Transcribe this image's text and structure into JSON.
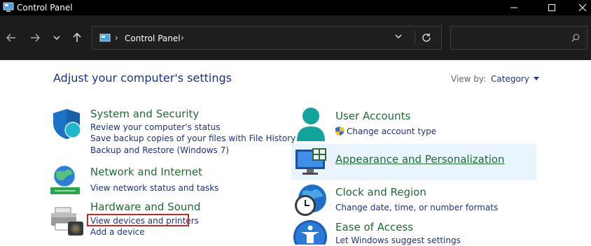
{
  "window": {
    "title": "Control Panel"
  },
  "nav": {
    "breadcrumb": "Control Panel",
    "search_placeholder": ""
  },
  "main": {
    "heading": "Adjust your computer's settings",
    "view_by_label": "View by:",
    "view_by_value": "Category",
    "left": [
      {
        "title": "System and Security",
        "icon": "shield-icon",
        "links": [
          "Review your computer's status",
          "Save backup copies of your files with File History",
          "Backup and Restore (Windows 7)"
        ]
      },
      {
        "title": "Network and Internet",
        "icon": "network-globe-icon",
        "links": [
          "View network status and tasks"
        ]
      },
      {
        "title": "Hardware and Sound",
        "icon": "printer-icon",
        "links": [
          "View devices and printers",
          "Add a device"
        ]
      }
    ],
    "right": [
      {
        "title": "User Accounts",
        "icon": "user-icon",
        "links": [
          "Change account type"
        ]
      },
      {
        "title": "Appearance and Personalization",
        "icon": "monitor-icon",
        "links": []
      },
      {
        "title": "Clock and Region",
        "icon": "clock-globe-icon",
        "links": [
          "Change date, time, or number formats"
        ]
      },
      {
        "title": "Ease of Access",
        "icon": "ease-of-access-icon",
        "links": [
          "Let Windows suggest settings"
        ]
      }
    ]
  },
  "colors": {
    "title_link": "#1e6c32",
    "link": "#1e3287",
    "hover_bg": "#e9f4fc",
    "highlight_border": "#c0282c"
  }
}
